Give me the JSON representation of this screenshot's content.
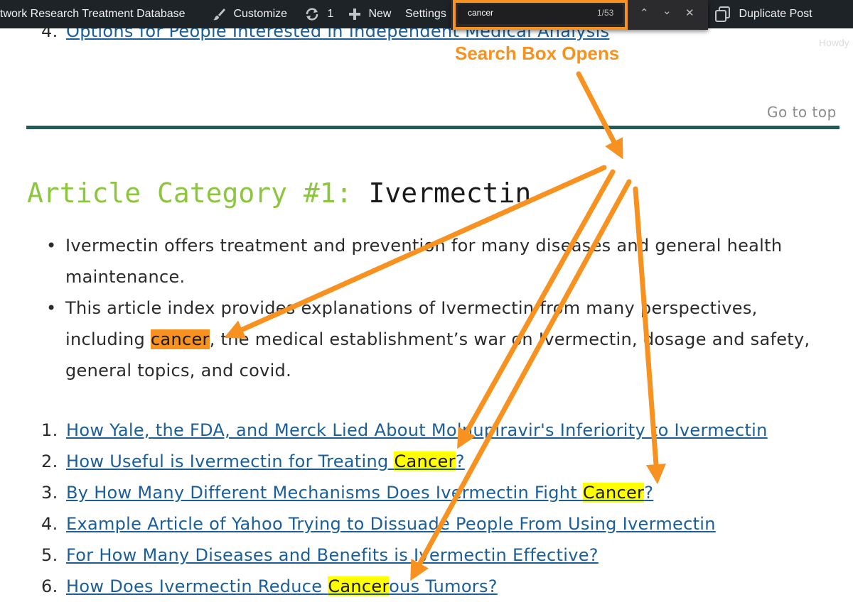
{
  "adminbar": {
    "site_name": "twork Research Treatment Database",
    "customize": "Customize",
    "updates_count": "1",
    "new_label": "New",
    "settings_label": "Settings",
    "duplicate_post": "Duplicate Post"
  },
  "findbar": {
    "query": "cancer",
    "match_count": "1/53"
  },
  "howdy": "Howdy",
  "annotation": "Search Box Opens",
  "top_item": {
    "number": "4.",
    "link_text": "Options for People Interested in Independent Medical Analysis"
  },
  "goto_top": "Go to top",
  "category": {
    "label": "Article Category #1:",
    "name": "Ivermectin"
  },
  "bullets": [
    {
      "text": "Ivermectin offers treatment and prevention for many diseases and general health maintenance."
    },
    {
      "before": "This article index provides explanations of Ivermectin from many perspectives, including ",
      "match": "cancer",
      "after": ", the medical establishment’s war on Ivermectin, dosage and safety, general topics, and covid."
    }
  ],
  "articles": [
    {
      "number": "1.",
      "text": "How Yale, the FDA, and Merck Lied About Molnupiravir's Inferiority to Ivermectin"
    },
    {
      "number": "2.",
      "before": "How Useful is Ivermectin for Treating ",
      "match": "Cancer",
      "after": "?"
    },
    {
      "number": "3.",
      "before": "By How Many Different Mechanisms Does Ivermectin Fight ",
      "match": "Cancer",
      "after": "?"
    },
    {
      "number": "4.",
      "text": "Example Article of Yahoo Trying to Dissuade People From Using Ivermectin"
    },
    {
      "number": "5.",
      "text": "For How Many Diseases and Benefits is Ivermectin Effective?"
    },
    {
      "number": "6.",
      "before": "How Does Ivermectin Reduce ",
      "match": "Cancer",
      "after": "ous Tumors?"
    }
  ],
  "colors": {
    "annotation_orange": "#f7911f",
    "highlight_yellow": "#ffff00",
    "link_blue": "#1a5e9a",
    "category_green": "#8cc63f",
    "divider_teal": "#1f5c5c"
  }
}
